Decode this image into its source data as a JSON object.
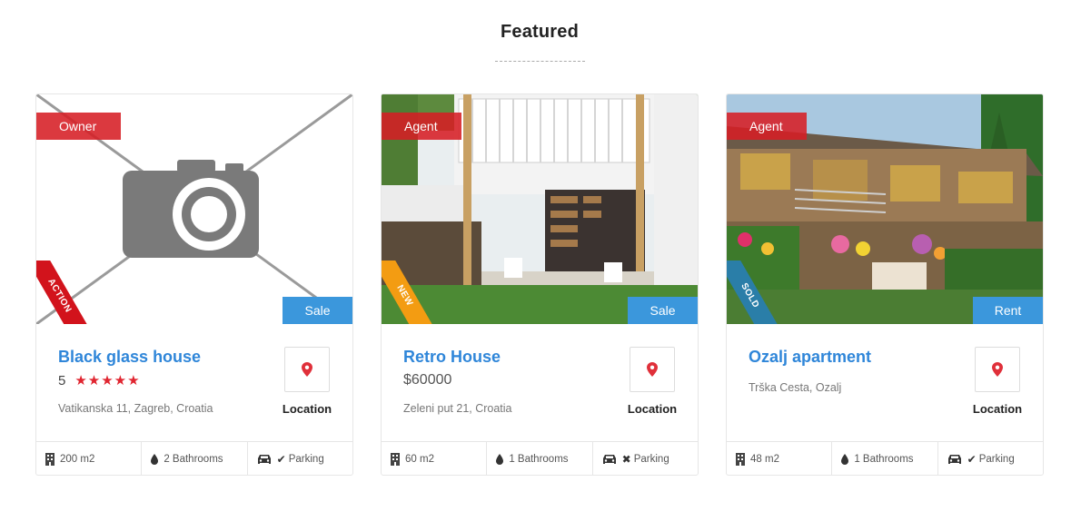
{
  "section": {
    "title": "Featured"
  },
  "colors": {
    "accent_blue": "#2f86d9",
    "role_badge_red": "#d61e24",
    "deal_badge_blue": "#3b97dc",
    "star_red": "#e02530"
  },
  "listings": [
    {
      "role_badge": "Owner",
      "ribbon": "ACTION",
      "ribbon_color": "#d2131c",
      "deal_badge": "Sale",
      "image": "camera-placeholder-icon",
      "title": "Black glass house",
      "rating_value": "5",
      "stars": "★★★★★",
      "address": "Vatikanska 11, Zagreb, Croatia",
      "location_label": "Location",
      "area": "200 m2",
      "bathrooms": "2 Bathrooms",
      "parking_mark": "✔",
      "parking": "Parking"
    },
    {
      "role_badge": "Agent",
      "ribbon": "NEW",
      "ribbon_color": "#f39c12",
      "deal_badge": "Sale",
      "image": "house-photo",
      "title": "Retro House",
      "price": "$60000",
      "address": "Zeleni put 21, Croatia",
      "location_label": "Location",
      "area": "60 m2",
      "bathrooms": "1 Bathrooms",
      "parking_mark": "✖",
      "parking": "Parking"
    },
    {
      "role_badge": "Agent",
      "ribbon": "SOLD",
      "ribbon_color": "#2a7ea8",
      "deal_badge": "Rent",
      "image": "apartment-photo",
      "title": "Ozalj apartment",
      "address": "Trška Cesta, Ozalj",
      "location_label": "Location",
      "area": "48 m2",
      "bathrooms": "1 Bathrooms",
      "parking_mark": "✔",
      "parking": "Parking"
    }
  ]
}
